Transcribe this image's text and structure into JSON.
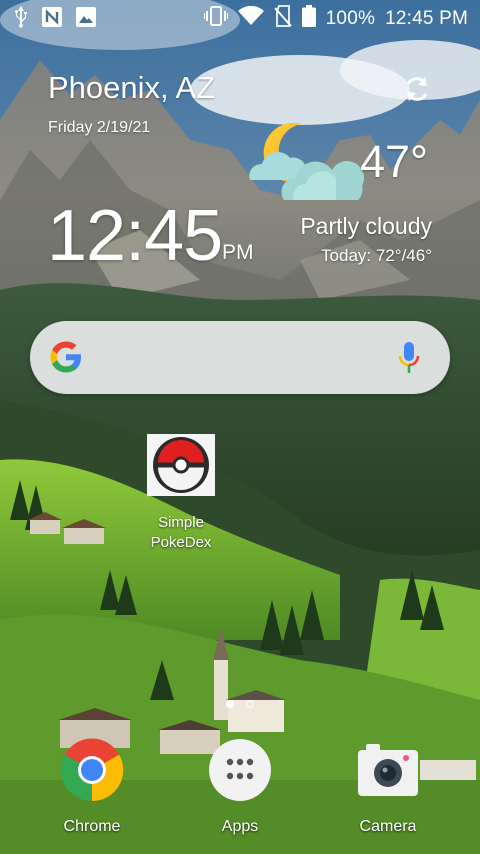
{
  "status_bar": {
    "battery": "100%",
    "time": "12:45 PM",
    "left_icons": [
      "usb-icon",
      "nfc-icon",
      "gallery-icon"
    ],
    "right_icons": [
      "vibrate-icon",
      "wifi-icon",
      "no-sim-icon",
      "battery-icon"
    ]
  },
  "widget": {
    "city": "Phoenix, AZ",
    "date": "Friday 2/19/21",
    "time": "12:45",
    "ampm": "PM",
    "temperature": "47°",
    "condition": "Partly cloudy",
    "today": "Today: 72°/46°",
    "weather_icon": "partly-cloudy-night-icon"
  },
  "search": {
    "logo": "google-logo-icon",
    "mic": "mic-icon"
  },
  "home_apps": [
    {
      "label": "Simple PokeDex",
      "label_lines": [
        "Simple",
        "PokeDex"
      ],
      "icon": "pokeball-icon"
    }
  ],
  "page_indicator": {
    "pages": 2,
    "current": 1
  },
  "dock": [
    {
      "label": "Chrome",
      "icon": "chrome-icon"
    },
    {
      "label": "Apps",
      "icon": "apps-grid-icon"
    },
    {
      "label": "Camera",
      "icon": "camera-icon"
    }
  ],
  "colors": {
    "search_bg": "#eceef0",
    "google_blue": "#4285F4",
    "google_red": "#EA4335",
    "google_yellow": "#FBBC05",
    "google_green": "#34A853"
  }
}
